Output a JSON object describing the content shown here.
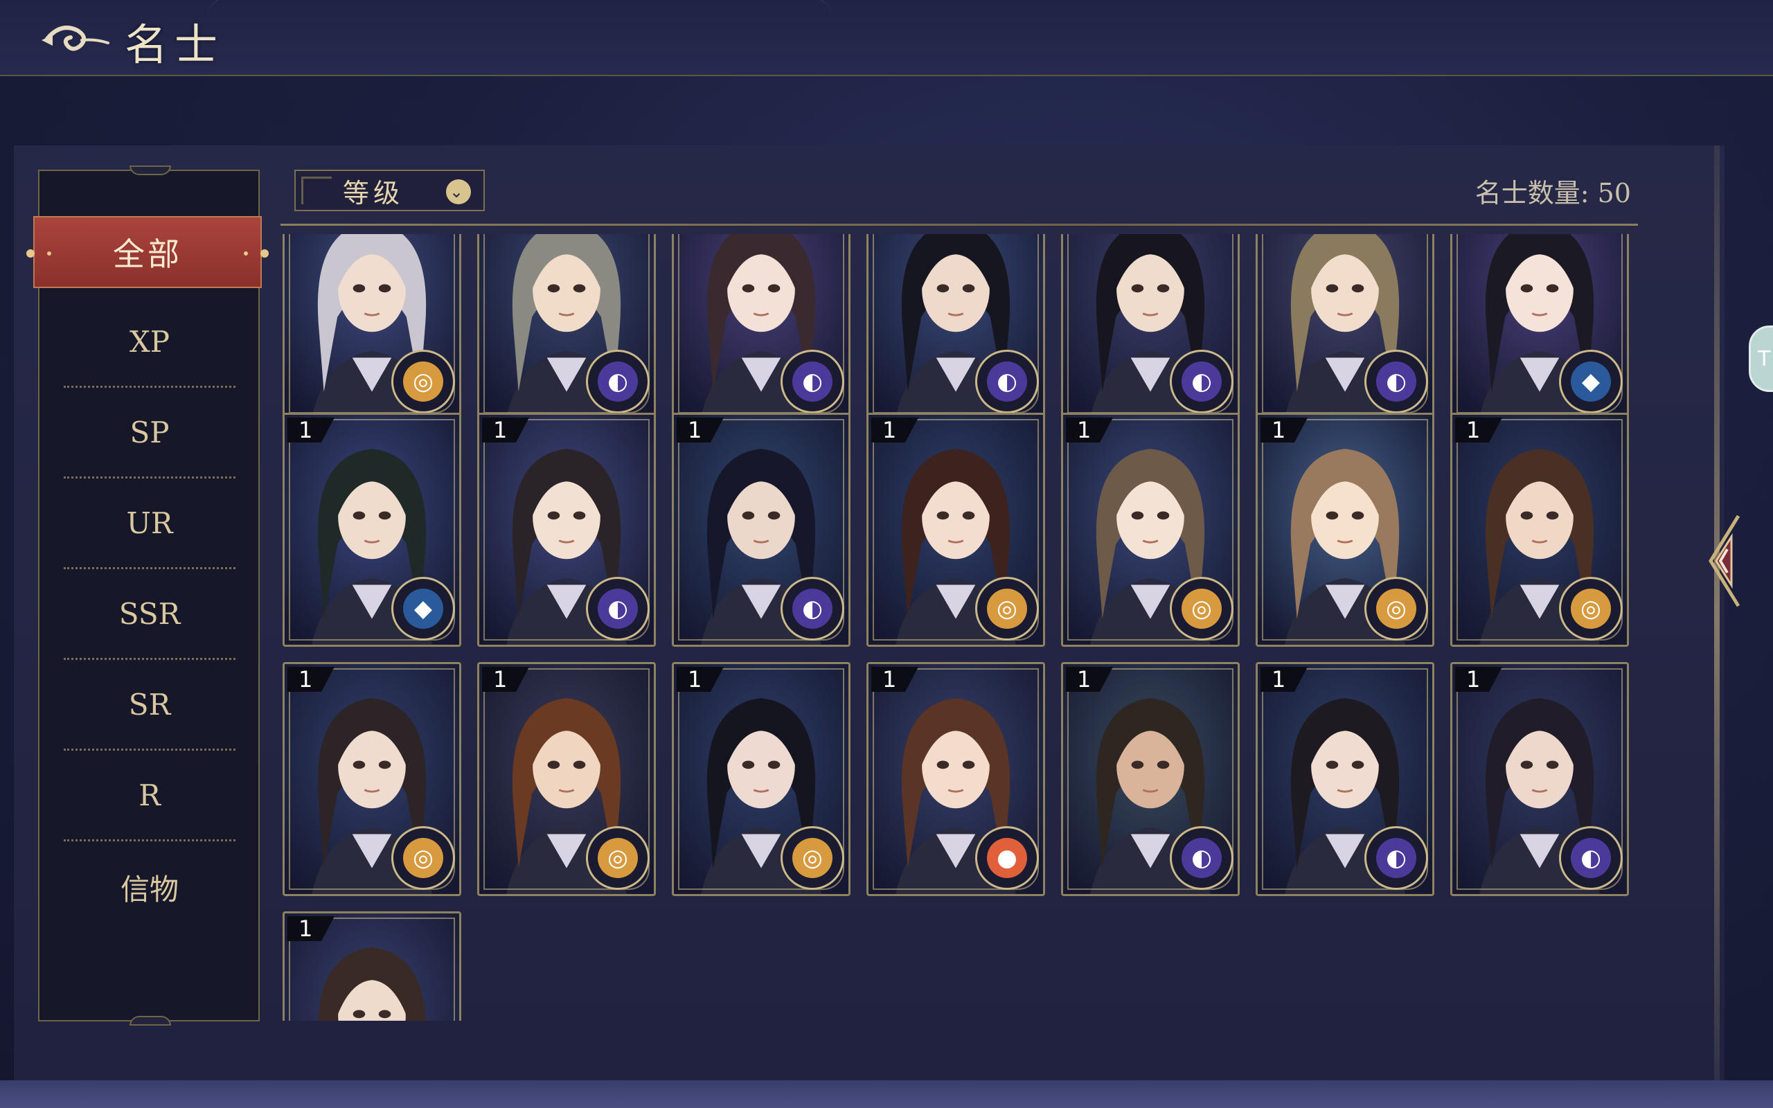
{
  "header": {
    "title": "名士"
  },
  "sidebar": {
    "active_tab": "全部",
    "tabs": [
      "XP",
      "SP",
      "UR",
      "SSR",
      "SR",
      "R",
      "信物"
    ]
  },
  "toolbar": {
    "sort_label": "等级",
    "count_text": "名士数量: 50"
  },
  "side_tab_label": "T",
  "colors": {
    "header_bg": "#1f2345",
    "panel_bg": "#262847",
    "active_tab": "#a9443d",
    "tab_text": "#d9c8a0",
    "gold_border": "#8f8260",
    "badge_gold": "#d89a3e",
    "badge_purple": "#4b3a9a",
    "badge_blue": "#2a5a9a",
    "badge_orange": "#e0603a"
  },
  "cards": [
    {
      "level": "",
      "badge": "gold",
      "hair": "#c9c6cf",
      "skin": "#f1ddd0",
      "bg": "#3f4a7e"
    },
    {
      "level": "",
      "badge": "purple",
      "hair": "#8a8a82",
      "skin": "#f0dcc8",
      "bg": "#3a4570"
    },
    {
      "level": "",
      "badge": "purple",
      "hair": "#3a2a30",
      "skin": "#f3e0d6",
      "bg": "#4a3f78"
    },
    {
      "level": "",
      "badge": "purple",
      "hair": "#161620",
      "skin": "#efd9cb",
      "bg": "#3a4a7a"
    },
    {
      "level": "",
      "badge": "purple",
      "hair": "#17161e",
      "skin": "#f0dccd",
      "bg": "#3c3e6a"
    },
    {
      "level": "",
      "badge": "purple",
      "hair": "#8a7a5e",
      "skin": "#f2dccb",
      "bg": "#45466c"
    },
    {
      "level": "",
      "badge": "blue",
      "hair": "#1b1a24",
      "skin": "#f5e2d8",
      "bg": "#4b3f7a"
    },
    {
      "level": "1",
      "badge": "blue",
      "hair": "#1f2a28",
      "skin": "#efdccc",
      "bg": "#3a467c"
    },
    {
      "level": "1",
      "badge": "purple",
      "hair": "#2a2428",
      "skin": "#f2e0d2",
      "bg": "#40477c"
    },
    {
      "level": "1",
      "badge": "purple",
      "hair": "#16172a",
      "skin": "#ecd8cb",
      "bg": "#30456e"
    },
    {
      "level": "1",
      "badge": "gold",
      "hair": "#3e221e",
      "skin": "#f3ddcf",
      "bg": "#2e3f6a"
    },
    {
      "level": "1",
      "badge": "gold",
      "hair": "#6e5a48",
      "skin": "#f4e2d5",
      "bg": "#3a4878"
    },
    {
      "level": "1",
      "badge": "gold",
      "hair": "#9a7a5e",
      "skin": "#f6e2cc",
      "bg": "#45608a"
    },
    {
      "level": "1",
      "badge": "gold",
      "hair": "#4a2f24",
      "skin": "#f0d8c6",
      "bg": "#2c3a62"
    },
    {
      "level": "1",
      "badge": "gold",
      "hair": "#2c2426",
      "skin": "#efdccf",
      "bg": "#33406c"
    },
    {
      "level": "1",
      "badge": "gold",
      "hair": "#6a3a22",
      "skin": "#f0d6c0",
      "bg": "#3a3a54"
    },
    {
      "level": "1",
      "badge": "gold",
      "hair": "#14151e",
      "skin": "#eedad0",
      "bg": "#2f3f6a"
    },
    {
      "level": "1",
      "badge": "orange",
      "hair": "#5a3424",
      "skin": "#f3dccb",
      "bg": "#37406a"
    },
    {
      "level": "1",
      "badge": "purple",
      "hair": "#2e2620",
      "skin": "#d9b49a",
      "bg": "#3a4a5e"
    },
    {
      "level": "1",
      "badge": "purple",
      "hair": "#1e1a22",
      "skin": "#f0dcd0",
      "bg": "#2f3e66"
    },
    {
      "level": "1",
      "badge": "purple",
      "hair": "#201c2a",
      "skin": "#eed8cc",
      "bg": "#333a62"
    },
    {
      "level": "1",
      "badge": "",
      "hair": "#3a2a26",
      "skin": "#efdbcc",
      "bg": "#3a4070"
    }
  ]
}
